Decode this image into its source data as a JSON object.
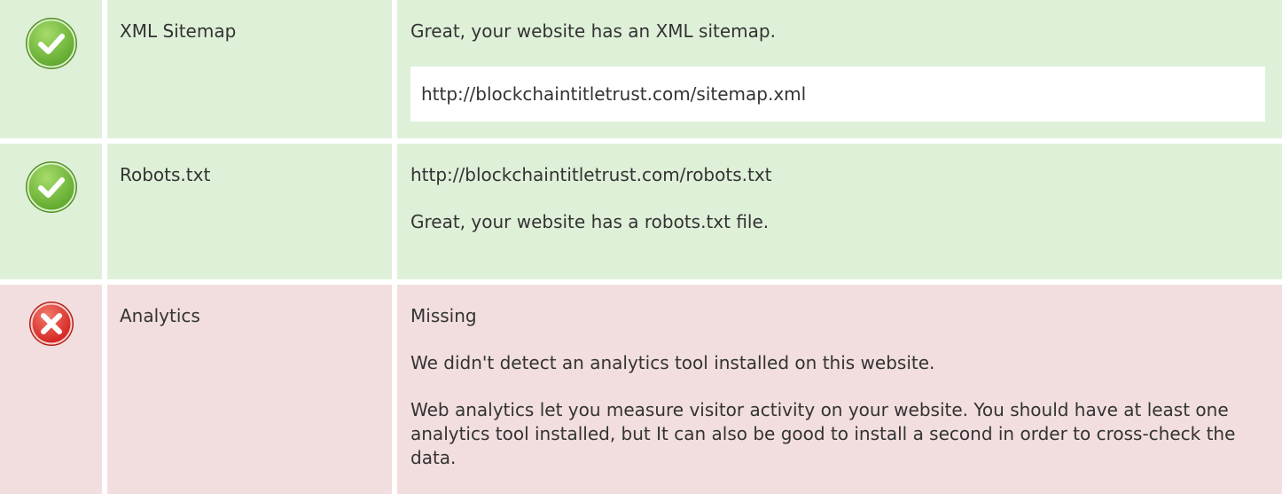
{
  "checks": [
    {
      "status": "pass",
      "icon": "check-icon",
      "name": "XML Sitemap",
      "message": "Great, your website has an XML sitemap.",
      "url": "http://blockchaintitletrust.com/sitemap.xml"
    },
    {
      "status": "pass",
      "icon": "check-icon",
      "name": "Robots.txt",
      "url": "http://blockchaintitletrust.com/robots.txt",
      "message": "Great, your website has a robots.txt file."
    },
    {
      "status": "fail",
      "icon": "cross-icon",
      "name": "Analytics",
      "state": "Missing",
      "message": "We didn't detect an analytics tool installed on this website.",
      "explanation": "Web analytics let you measure visitor activity on your website. You should have at least one analytics tool installed, but It can also be good to install a second in order to cross-check the data."
    }
  ],
  "colors": {
    "pass_bg": "#dff0d8",
    "fail_bg": "#f2dede",
    "check_green": "#7cc24a",
    "cross_red": "#e0322f"
  }
}
